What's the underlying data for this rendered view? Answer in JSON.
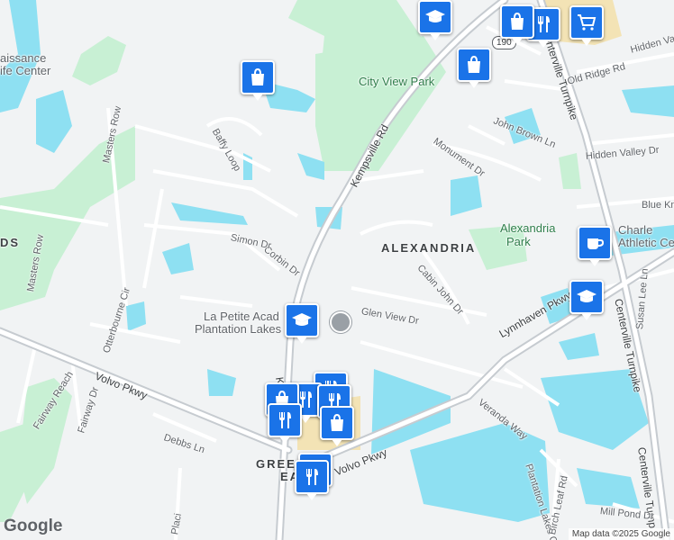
{
  "map": {
    "branding": {
      "logo_text": "Google",
      "attribution": "Map data ©2025 Google"
    },
    "colors": {
      "land": "#f1f3f4",
      "water": "#8ee0f2",
      "park": "#c8f0d4",
      "road": "#ffffff",
      "major_road": "#c6cbd0",
      "pin": "#1a73e8"
    },
    "areas": [
      {
        "name": "ALEXANDRIA"
      },
      {
        "name": "GREEN"
      },
      {
        "name": "EA"
      },
      {
        "name": "DS"
      }
    ],
    "places": [
      {
        "name": "City View Park",
        "type": "park"
      },
      {
        "name": "Alexandria",
        "line2": "Park",
        "type": "park"
      },
      {
        "name": "Charle",
        "line2": "Athletic Ce",
        "type": "poi"
      },
      {
        "name": "La Petite Acad",
        "line2": "Plantation Lakes",
        "type": "poi"
      },
      {
        "name": "aissance",
        "line2": "ife Center",
        "type": "poi"
      }
    ],
    "roads": [
      "Kempsville Rd",
      "Kem",
      "Volvo Pkwy",
      "Volvo Pkwy",
      "Lynnhaven Pkwy",
      "Centerville Turnpike",
      "Centerville Turnpike",
      "Centerville Turnp",
      "Glen View Dr",
      "Cabin John Dr",
      "Monument Dr",
      "John Brown Ln",
      "Old Ridge Rd",
      "Hidden Valley Dr",
      "Hidden Valley",
      "Blue Kn",
      "Corbin Dr",
      "Simon Dr",
      "Baffy Loop",
      "Masters Row",
      "Masters Row",
      "Otterbourne Cir",
      "Fairway Reach",
      "Fairway Dr",
      "Debbs Ln",
      "Veranda Way",
      "Plantation Lakes Ct",
      "Birch Leaf Rd",
      "Mill Pond Dr",
      "Susan Lee Ln",
      "Placi"
    ],
    "route_shield": "190",
    "markers": [
      {
        "icon": "graduation-cap-icon"
      },
      {
        "icon": "shopping-bag-icon"
      },
      {
        "icon": "cutlery-icon"
      },
      {
        "icon": "shopping-cart-icon"
      },
      {
        "icon": "shopping-bag-icon"
      },
      {
        "icon": "shopping-bag-icon"
      },
      {
        "icon": "coffee-cup-icon"
      },
      {
        "icon": "graduation-cap-icon"
      },
      {
        "icon": "graduation-cap-icon"
      },
      {
        "icon": "cutlery-icon"
      },
      {
        "icon": "cutlery-icon"
      },
      {
        "icon": "shopping-bag-icon"
      },
      {
        "icon": "cutlery-icon"
      },
      {
        "icon": "cutlery-icon"
      },
      {
        "icon": "shopping-bag-icon"
      },
      {
        "icon": "cutlery-icon"
      },
      {
        "icon": "cutlery-icon"
      }
    ]
  }
}
